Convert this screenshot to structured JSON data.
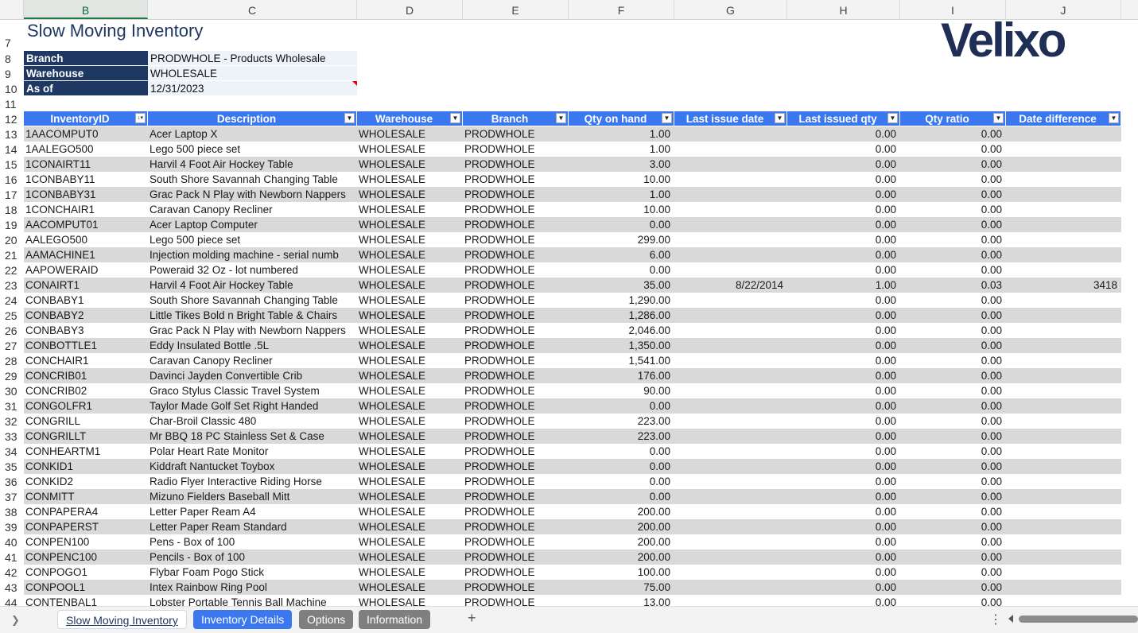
{
  "columns": [
    "B",
    "C",
    "D",
    "E",
    "F",
    "G",
    "H",
    "I",
    "J"
  ],
  "row_numbers": [
    "7",
    "8",
    "9",
    "10",
    "11",
    "12",
    "13",
    "14",
    "15",
    "16",
    "17",
    "18",
    "19",
    "20",
    "21",
    "22",
    "23",
    "24",
    "25",
    "26",
    "27",
    "28",
    "29",
    "30",
    "31",
    "32",
    "33",
    "34",
    "35",
    "36",
    "37",
    "38",
    "39",
    "40",
    "41",
    "42",
    "43",
    "44"
  ],
  "report": {
    "title": "Slow Moving Inventory",
    "logo": "Velixo",
    "params": [
      {
        "label": "Branch",
        "value": "PRODWHOLE - Products Wholesale"
      },
      {
        "label": "Warehouse",
        "value": "WHOLESALE"
      },
      {
        "label": "As of",
        "value": "12/31/2023"
      }
    ]
  },
  "table": {
    "headers": [
      "InventoryID",
      "Description",
      "Warehouse",
      "Branch",
      "Qty on hand",
      "Last issue date",
      "Last issued qty",
      "Qty ratio",
      "Date difference"
    ],
    "filter_icons": [
      "sort-filter-icon",
      "filter-dropdown-icon",
      "filter-dropdown-icon",
      "filter-dropdown-icon",
      "filter-dropdown-icon",
      "filter-dropdown-icon",
      "filter-dropdown-icon",
      "filter-dropdown-icon",
      "filter-dropdown-icon"
    ],
    "rows": [
      [
        "1AACOMPUT0",
        "Acer Laptop X",
        "WHOLESALE",
        "PRODWHOLE",
        "1.00",
        "",
        "0.00",
        "0.00",
        ""
      ],
      [
        "1AALEGO500",
        "Lego 500 piece set",
        "WHOLESALE",
        "PRODWHOLE",
        "1.00",
        "",
        "0.00",
        "0.00",
        ""
      ],
      [
        "1CONAIRT11",
        "Harvil 4 Foot Air Hockey Table",
        "WHOLESALE",
        "PRODWHOLE",
        "3.00",
        "",
        "0.00",
        "0.00",
        ""
      ],
      [
        "1CONBABY11",
        "South Shore Savannah Changing Table",
        "WHOLESALE",
        "PRODWHOLE",
        "10.00",
        "",
        "0.00",
        "0.00",
        ""
      ],
      [
        "1CONBABY31",
        "Grac Pack N Play with Newborn Nappers",
        "WHOLESALE",
        "PRODWHOLE",
        "1.00",
        "",
        "0.00",
        "0.00",
        ""
      ],
      [
        "1CONCHAIR1",
        "Caravan Canopy Recliner",
        "WHOLESALE",
        "PRODWHOLE",
        "10.00",
        "",
        "0.00",
        "0.00",
        ""
      ],
      [
        "AACOMPUT01",
        "Acer Laptop Computer",
        "WHOLESALE",
        "PRODWHOLE",
        "0.00",
        "",
        "0.00",
        "0.00",
        ""
      ],
      [
        "AALEGO500",
        "Lego 500 piece set",
        "WHOLESALE",
        "PRODWHOLE",
        "299.00",
        "",
        "0.00",
        "0.00",
        ""
      ],
      [
        "AAMACHINE1",
        "Injection molding machine - serial numb",
        "WHOLESALE",
        "PRODWHOLE",
        "6.00",
        "",
        "0.00",
        "0.00",
        ""
      ],
      [
        "AAPOWERAID",
        "Poweraid 32 Oz - lot numbered",
        "WHOLESALE",
        "PRODWHOLE",
        "0.00",
        "",
        "0.00",
        "0.00",
        ""
      ],
      [
        "CONAIRT1",
        "Harvil 4 Foot Air Hockey Table",
        "WHOLESALE",
        "PRODWHOLE",
        "35.00",
        "8/22/2014",
        "1.00",
        "0.03",
        "3418"
      ],
      [
        "CONBABY1",
        "South Shore Savannah Changing Table",
        "WHOLESALE",
        "PRODWHOLE",
        "1,290.00",
        "",
        "0.00",
        "0.00",
        ""
      ],
      [
        "CONBABY2",
        "Little Tikes Bold n Bright Table & Chairs",
        "WHOLESALE",
        "PRODWHOLE",
        "1,286.00",
        "",
        "0.00",
        "0.00",
        ""
      ],
      [
        "CONBABY3",
        "Grac Pack N Play with Newborn Nappers",
        "WHOLESALE",
        "PRODWHOLE",
        "2,046.00",
        "",
        "0.00",
        "0.00",
        ""
      ],
      [
        "CONBOTTLE1",
        "Eddy Insulated Bottle .5L",
        "WHOLESALE",
        "PRODWHOLE",
        "1,350.00",
        "",
        "0.00",
        "0.00",
        ""
      ],
      [
        "CONCHAIR1",
        "Caravan Canopy Recliner",
        "WHOLESALE",
        "PRODWHOLE",
        "1,541.00",
        "",
        "0.00",
        "0.00",
        ""
      ],
      [
        "CONCRIB01",
        "Davinci Jayden Convertible Crib",
        "WHOLESALE",
        "PRODWHOLE",
        "176.00",
        "",
        "0.00",
        "0.00",
        ""
      ],
      [
        "CONCRIB02",
        "Graco Stylus Classic Travel System",
        "WHOLESALE",
        "PRODWHOLE",
        "90.00",
        "",
        "0.00",
        "0.00",
        ""
      ],
      [
        "CONGOLFR1",
        "Taylor Made Golf Set Right Handed",
        "WHOLESALE",
        "PRODWHOLE",
        "0.00",
        "",
        "0.00",
        "0.00",
        ""
      ],
      [
        "CONGRILL",
        "Char-Broil Classic 480",
        "WHOLESALE",
        "PRODWHOLE",
        "223.00",
        "",
        "0.00",
        "0.00",
        ""
      ],
      [
        "CONGRILLT",
        "Mr BBQ 18 PC Stainless Set & Case",
        "WHOLESALE",
        "PRODWHOLE",
        "223.00",
        "",
        "0.00",
        "0.00",
        ""
      ],
      [
        "CONHEARTM1",
        "Polar Heart Rate Monitor",
        "WHOLESALE",
        "PRODWHOLE",
        "0.00",
        "",
        "0.00",
        "0.00",
        ""
      ],
      [
        "CONKID1",
        "Kiddraft Nantucket Toybox",
        "WHOLESALE",
        "PRODWHOLE",
        "0.00",
        "",
        "0.00",
        "0.00",
        ""
      ],
      [
        "CONKID2",
        "Radio Flyer Interactive Riding Horse",
        "WHOLESALE",
        "PRODWHOLE",
        "0.00",
        "",
        "0.00",
        "0.00",
        ""
      ],
      [
        "CONMITT",
        "Mizuno Fielders Baseball Mitt",
        "WHOLESALE",
        "PRODWHOLE",
        "0.00",
        "",
        "0.00",
        "0.00",
        ""
      ],
      [
        "CONPAPERA4",
        "Letter Paper Ream A4",
        "WHOLESALE",
        "PRODWHOLE",
        "200.00",
        "",
        "0.00",
        "0.00",
        ""
      ],
      [
        "CONPAPERST",
        "Letter Paper Ream Standard",
        "WHOLESALE",
        "PRODWHOLE",
        "200.00",
        "",
        "0.00",
        "0.00",
        ""
      ],
      [
        "CONPEN100",
        "Pens - Box of 100",
        "WHOLESALE",
        "PRODWHOLE",
        "200.00",
        "",
        "0.00",
        "0.00",
        ""
      ],
      [
        "CONPENC100",
        "Pencils - Box of 100",
        "WHOLESALE",
        "PRODWHOLE",
        "200.00",
        "",
        "0.00",
        "0.00",
        ""
      ],
      [
        "CONPOGO1",
        "Flybar Foam Pogo Stick",
        "WHOLESALE",
        "PRODWHOLE",
        "100.00",
        "",
        "0.00",
        "0.00",
        ""
      ],
      [
        "CONPOOL1",
        "Intex Rainbow Ring Pool",
        "WHOLESALE",
        "PRODWHOLE",
        "75.00",
        "",
        "0.00",
        "0.00",
        ""
      ],
      [
        "CONTENBAL1",
        "Lobster Portable Tennis Ball Machine",
        "WHOLESALE",
        "PRODWHOLE",
        "13.00",
        "",
        "0.00",
        "0.00",
        ""
      ]
    ]
  },
  "sheet_tabs": [
    {
      "label": "Slow Moving Inventory",
      "style": "active"
    },
    {
      "label": "Inventory Details",
      "style": "blue"
    },
    {
      "label": "Options",
      "style": "gray"
    },
    {
      "label": "Information",
      "style": "gray"
    }
  ],
  "icons": {
    "nav_next": "chevron-right-icon",
    "add_sheet": "plus-icon",
    "more": "more-vertical-icon"
  },
  "colors": {
    "header_blue": "#3b78f0",
    "label_navy": "#1f3763",
    "band_gray": "#d9d9d9"
  }
}
